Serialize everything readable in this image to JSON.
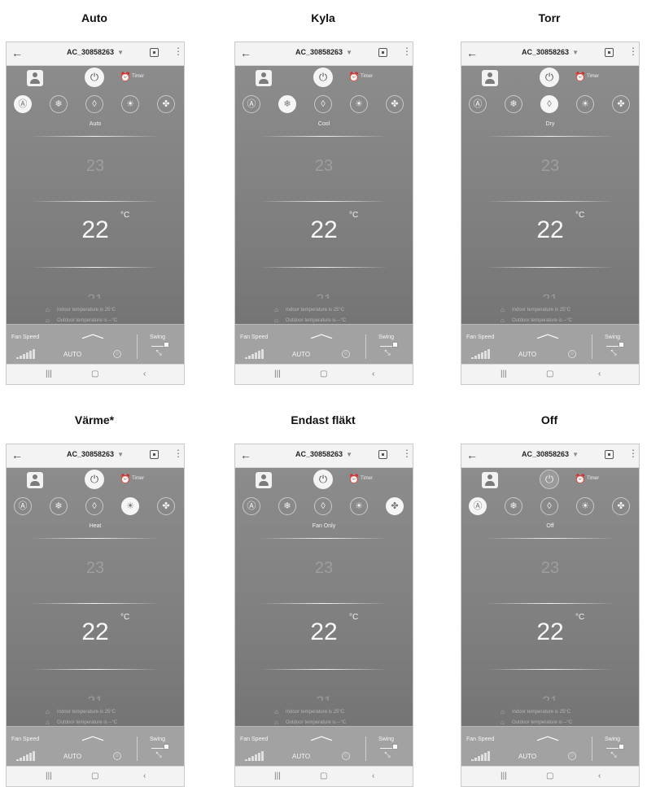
{
  "screen": {
    "device_name": "AC_30858263",
    "timer_label": "Timer",
    "set_temp_up": "23",
    "set_temp": "22",
    "set_temp_down": "21",
    "unit": "°C",
    "indoor_text": "Indoor temperature is 25°C",
    "outdoor_text": "Outdoor temperature is --°C",
    "fan_speed_label": "Fan Speed",
    "fan_speed_value": "AUTO",
    "swing_label": "Swing"
  },
  "modes": [
    "auto",
    "cool",
    "dry",
    "heat",
    "fan"
  ],
  "mode_glyphs": [
    "Ⓐ",
    "❄",
    "◊",
    "☀",
    "✤"
  ],
  "panels": [
    {
      "caption": "Auto",
      "mode_label": "Auto",
      "active_mode": 0,
      "power_on": true
    },
    {
      "caption": "Kyla",
      "mode_label": "Cool",
      "active_mode": 1,
      "power_on": true
    },
    {
      "caption": "Torr",
      "mode_label": "Dry",
      "active_mode": 2,
      "power_on": true
    },
    {
      "caption": "Värme*",
      "mode_label": "Heat",
      "active_mode": 3,
      "power_on": true
    },
    {
      "caption": "Endast fläkt",
      "mode_label": "Fan Only",
      "active_mode": 4,
      "power_on": true
    },
    {
      "caption": "Off",
      "mode_label": "Off",
      "active_mode": 0,
      "power_on": false
    }
  ],
  "colors": {
    "active": "#f5f5f5",
    "screen": "#8a8a8a"
  }
}
